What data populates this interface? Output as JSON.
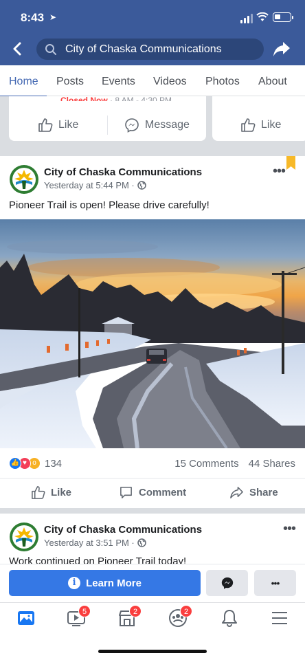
{
  "status": {
    "time": "8:43"
  },
  "header": {
    "search_text": "City of Chaska Communications"
  },
  "tabs": [
    "Home",
    "Posts",
    "Events",
    "Videos",
    "Photos",
    "About"
  ],
  "info_card": {
    "closed_label": "Closed Now",
    "hours": " · 8 AM - 4:30 PM",
    "like_label": "Like",
    "message_label": "Message"
  },
  "info_card_2": {
    "like_label": "Like"
  },
  "post": {
    "author": "City of Chaska Communications",
    "time": "Yesterday at 5:44 PM ·",
    "text": "Pioneer Trail is open! Please drive carefully!",
    "reaction_count": "134",
    "comments": "15 Comments",
    "shares": "44 Shares",
    "actions": {
      "like": "Like",
      "comment": "Comment",
      "share": "Share"
    }
  },
  "post2": {
    "author": "City of Chaska Communications",
    "time": "Yesterday at 3:51 PM ·",
    "text": "Work continued on Pioneer Trail today!"
  },
  "cta": {
    "learn_more": "Learn More"
  },
  "bottom_nav": {
    "badges": {
      "watch": "5",
      "marketplace": "2",
      "groups": "2"
    }
  },
  "colors": {
    "header": "#3b5a9a",
    "accent": "#4267b2",
    "cta": "#3578e5",
    "badge": "#fa3e3e"
  }
}
